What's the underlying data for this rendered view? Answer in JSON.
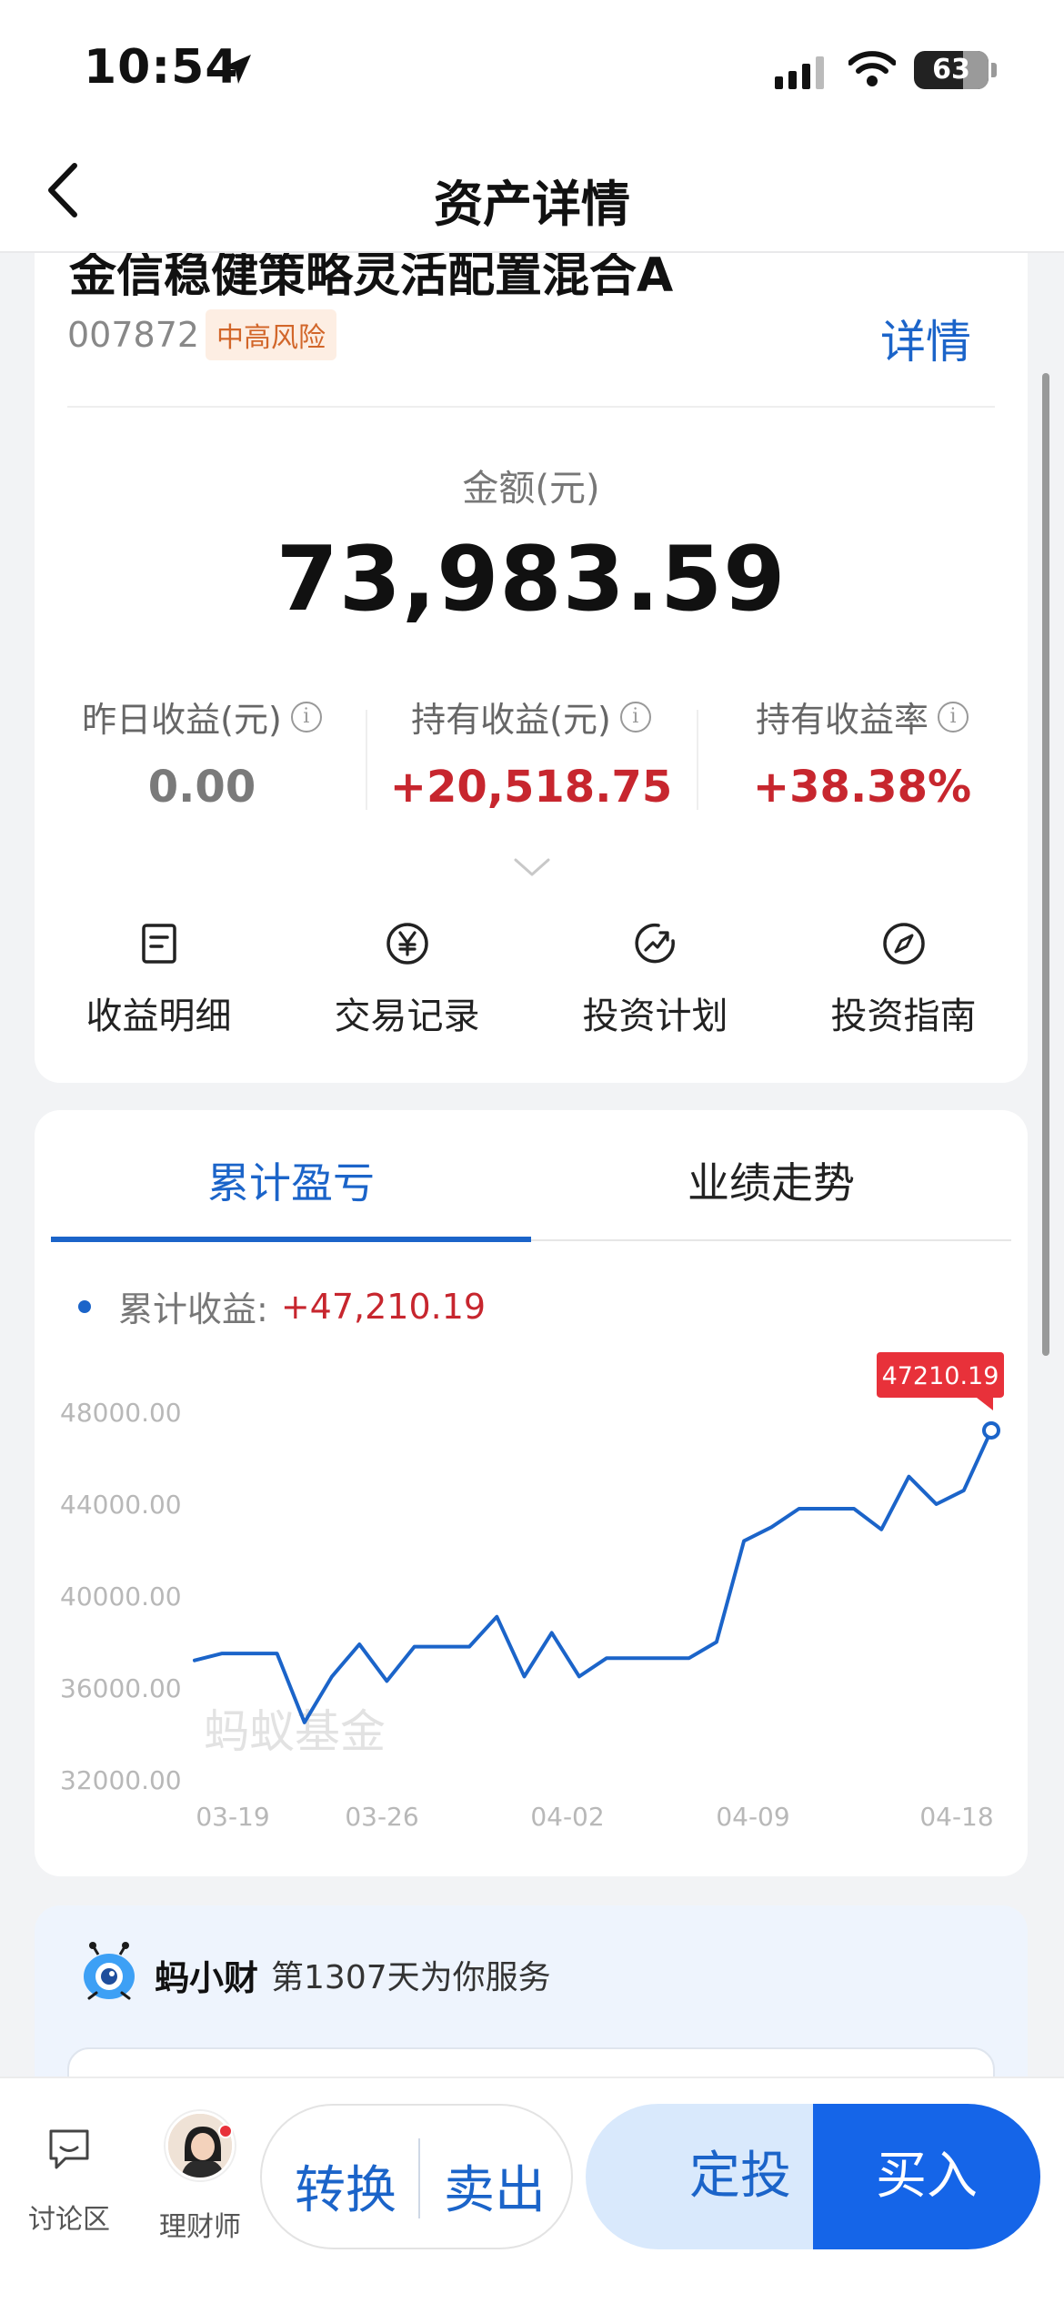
{
  "status_bar": {
    "time": "10:54",
    "battery": "63"
  },
  "nav": {
    "title": "资产详情"
  },
  "fund": {
    "name": "金信稳健策略灵活配置混合A",
    "code": "007872",
    "risk": "中高风险",
    "detail_label": "详情"
  },
  "amount": {
    "label": "金额(元)",
    "value": "73,983.59"
  },
  "stats": [
    {
      "label": "昨日收益(元)",
      "value": "0.00",
      "color": "#7a7a7a"
    },
    {
      "label": "持有收益(元)",
      "value": "+20,518.75",
      "color": "#c7262e"
    },
    {
      "label": "持有收益率",
      "value": "+38.38%",
      "color": "#c7262e"
    }
  ],
  "quick_actions": [
    {
      "label": "收益明细",
      "icon": "document-icon"
    },
    {
      "label": "交易记录",
      "icon": "yen-icon"
    },
    {
      "label": "投资计划",
      "icon": "trend-icon"
    },
    {
      "label": "投资指南",
      "icon": "compass-icon"
    }
  ],
  "tabs": [
    "累计盈亏",
    "业绩走势"
  ],
  "cumulative": {
    "label": "累计收益:",
    "value": "+47,210.19"
  },
  "watermark": "蚂蚁基金",
  "chart_data": {
    "type": "line",
    "x_ticks": [
      "03-19",
      "03-26",
      "04-02",
      "04-09",
      "04-18"
    ],
    "y_ticks": [
      "48000.00",
      "44000.00",
      "40000.00",
      "36000.00",
      "32000.00"
    ],
    "ylim": [
      32000,
      48000
    ],
    "values": [
      37200,
      37500,
      37500,
      37500,
      34500,
      36500,
      37900,
      36300,
      37800,
      37800,
      37800,
      39100,
      36500,
      38400,
      36500,
      37300,
      37300,
      37300,
      37300,
      38000,
      42400,
      43000,
      43800,
      43800,
      43800,
      42900,
      45200,
      44000,
      44600,
      47210.19
    ],
    "last_label": "47210.19",
    "line_color": "#1b64c9",
    "label_color": "#e8313a"
  },
  "assistant": {
    "name": "蚂小财",
    "text": "第1307天为你服务"
  },
  "bottom": {
    "discuss": "讨论区",
    "advisor": "理财师",
    "convert": "转换",
    "sell": "卖出",
    "sip": "定投",
    "buy": "买入"
  }
}
